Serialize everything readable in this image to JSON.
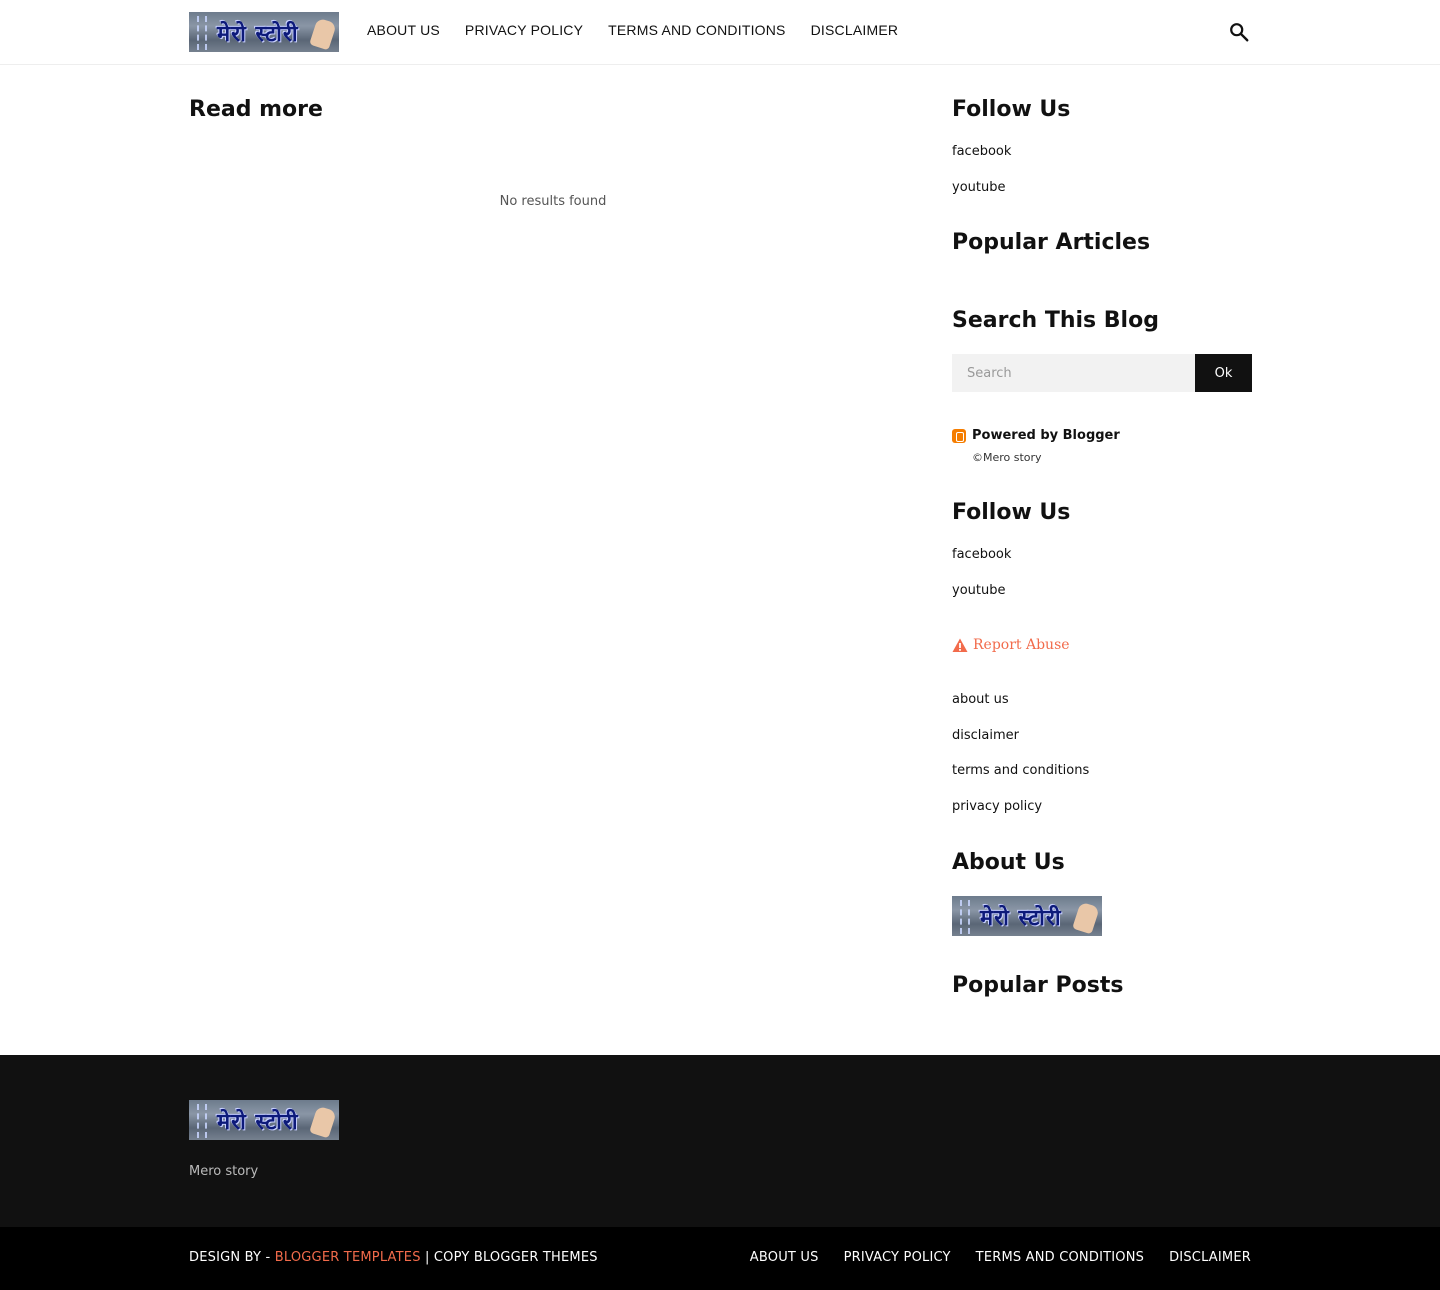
{
  "header": {
    "logo_text": "मेरो स्टोरी",
    "nav": [
      "ABOUT US",
      "PRIVACY POLICY",
      "TERMS AND CONDITIONS",
      "DISCLAIMER"
    ]
  },
  "main": {
    "title": "Read more",
    "empty_message": "No results found"
  },
  "sidebar": {
    "follow_us_1": {
      "title": "Follow Us",
      "links": [
        "facebook",
        "youtube"
      ]
    },
    "popular_articles": {
      "title": "Popular Articles"
    },
    "search": {
      "title": "Search This Blog",
      "placeholder": "Search",
      "button": "Ok"
    },
    "powered": {
      "label": "Powered by Blogger",
      "copyright": "©Mero story"
    },
    "follow_us_2": {
      "title": "Follow Us",
      "links": [
        "facebook",
        "youtube"
      ]
    },
    "report_abuse": "Report Abuse",
    "pages": [
      "about us",
      "disclaimer",
      "terms and conditions",
      "privacy policy"
    ],
    "about_us": {
      "title": "About Us"
    },
    "popular_posts": {
      "title": "Popular Posts"
    }
  },
  "footer": {
    "tagline": "Mero story",
    "credits_prefix": "DESIGN BY - ",
    "credits_link": "BLOGGER TEMPLATES",
    "credits_suffix": " | COPY BLOGGER THEMES",
    "nav": [
      "ABOUT US",
      "PRIVACY POLICY",
      "TERMS AND CONDITIONS",
      "DISCLAIMER"
    ]
  },
  "colors": {
    "accent": "#f26b4b",
    "footer_bg": "#111111",
    "footer_bottom_bg": "#000000"
  }
}
